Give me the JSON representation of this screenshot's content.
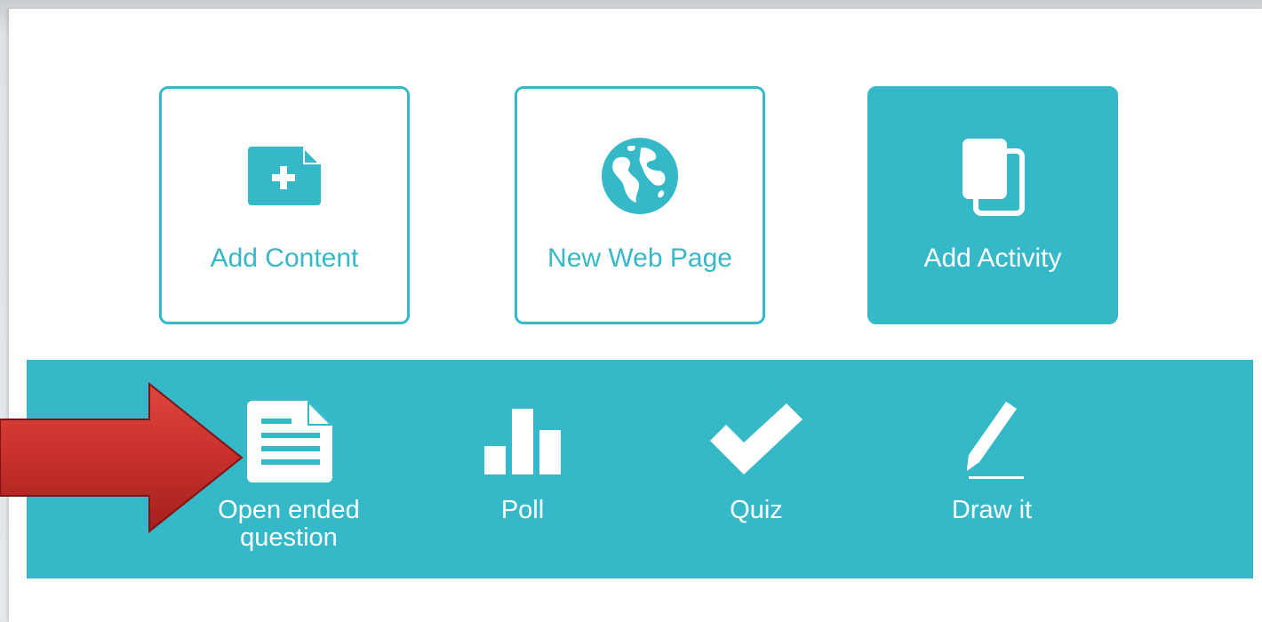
{
  "cards": [
    {
      "label": "Add Content",
      "icon": "add-content-icon",
      "active": false
    },
    {
      "label": "New Web Page",
      "icon": "globe-icon",
      "active": false
    },
    {
      "label": "Add Activity",
      "icon": "add-activity-icon",
      "active": true
    }
  ],
  "activities": [
    {
      "label": "Open ended question",
      "icon": "document-icon"
    },
    {
      "label": "Poll",
      "icon": "bar-chart-icon"
    },
    {
      "label": "Quiz",
      "icon": "checkmark-icon"
    },
    {
      "label": "Draw it",
      "icon": "pencil-icon"
    }
  ],
  "colors": {
    "accent": "#35b8c8",
    "arrow": "#c8302c",
    "white": "#ffffff"
  }
}
